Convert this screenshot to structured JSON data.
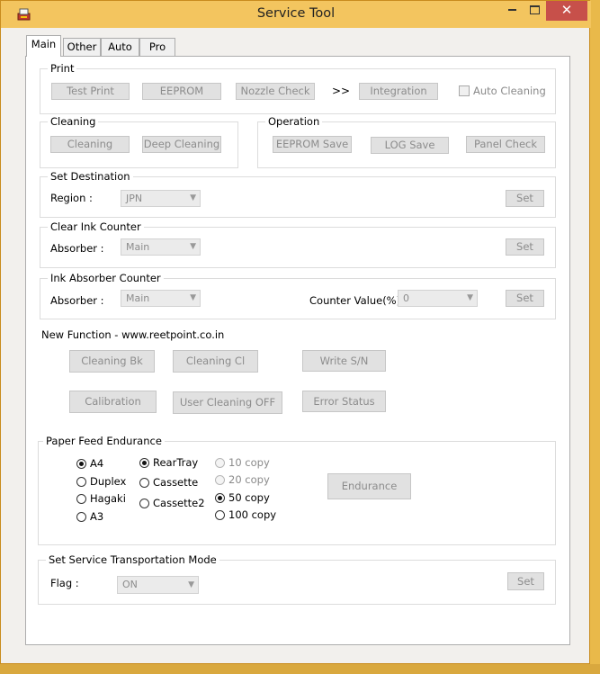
{
  "window": {
    "title": "Service Tool",
    "minimize": "▭",
    "maximize": "☐",
    "close": "✕"
  },
  "tabs": [
    "Main",
    "Other",
    "Auto",
    "Pro"
  ],
  "print": {
    "legend": "Print",
    "test_print": "Test Print",
    "eeprom": "EEPROM",
    "nozzle_check": "Nozzle Check",
    "arrows": ">>",
    "integration": "Integration",
    "auto_cleaning": "Auto Cleaning"
  },
  "cleaning": {
    "legend": "Cleaning",
    "cleaning": "Cleaning",
    "deep_cleaning": "Deep Cleaning"
  },
  "operation": {
    "legend": "Operation",
    "eeprom_save": "EEPROM Save",
    "log_save": "LOG Save",
    "panel_check": "Panel Check"
  },
  "set_destination": {
    "legend": "Set Destination",
    "region_label": "Region :",
    "region_value": "JPN",
    "set": "Set"
  },
  "clear_ink": {
    "legend": "Clear Ink Counter",
    "absorber_label": "Absorber :",
    "absorber_value": "Main",
    "set": "Set"
  },
  "ink_absorber": {
    "legend": "Ink Absorber Counter",
    "absorber_label": "Absorber :",
    "absorber_value": "Main",
    "counter_label": "Counter Value(%) :",
    "counter_value": "0",
    "set": "Set"
  },
  "new_function": {
    "heading": "New Function - www.reetpoint.co.in",
    "cleaning_bk": "Cleaning Bk",
    "cleaning_cl": "Cleaning Cl",
    "write_sn": "Write S/N",
    "calibration": "Calibration",
    "user_cleaning_off": "User Cleaning OFF",
    "error_status": "Error Status"
  },
  "paper_feed": {
    "legend": "Paper Feed Endurance",
    "sizes": [
      "A4",
      "Duplex",
      "Hagaki",
      "A3"
    ],
    "trays": [
      "RearTray",
      "Cassette",
      "Cassette2"
    ],
    "copies": [
      "10 copy",
      "20 copy",
      "50 copy",
      "100 copy"
    ],
    "endurance": "Endurance"
  },
  "transport": {
    "legend": "Set Service Transportation Mode",
    "flag_label": "Flag :",
    "flag_value": "ON",
    "set": "Set"
  },
  "colors": {
    "title_bar": "#f3c55f",
    "close_button": "#c7504a",
    "desktop": "#e9b94a"
  }
}
